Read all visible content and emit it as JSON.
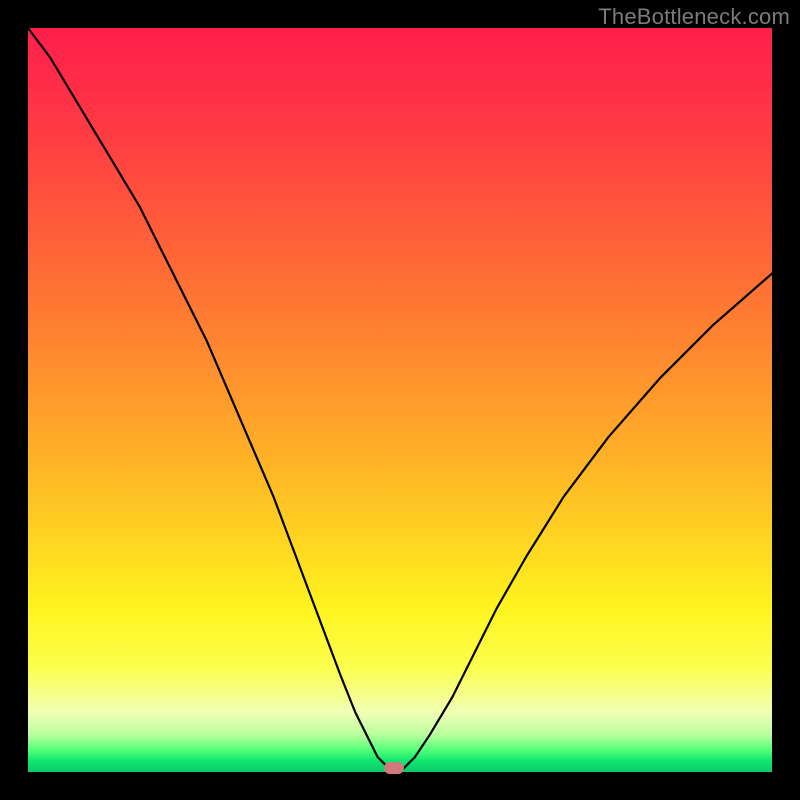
{
  "watermark": "TheBottleneck.com",
  "chart_data": {
    "type": "line",
    "title": "",
    "xlabel": "",
    "ylabel": "",
    "xlim": [
      0,
      100
    ],
    "ylim": [
      0,
      100
    ],
    "notes": "Y-axis encoded by color gradient: red≈100 (top) → green≈0 (bottom). Curve is a V-shaped mismatch/bottleneck curve with minimum ≈0 near x≈49.",
    "series": [
      {
        "name": "bottleneck-curve",
        "x": [
          0,
          3,
          6,
          9,
          12,
          15,
          18,
          21,
          24,
          27,
          30,
          33,
          36,
          39,
          42,
          44,
          46,
          47,
          48,
          49,
          50,
          51,
          52,
          54,
          57,
          60,
          63,
          67,
          72,
          78,
          85,
          92,
          100
        ],
        "values": [
          100,
          96,
          91,
          86,
          81,
          76,
          70,
          64,
          58,
          51,
          44,
          37,
          29,
          21,
          13,
          8,
          4,
          2,
          1,
          0,
          0,
          1,
          2,
          5,
          10,
          16,
          22,
          29,
          37,
          45,
          53,
          60,
          67
        ]
      }
    ],
    "marker": {
      "x": 49.2,
      "y": 0.5,
      "color": "#cf7a7d"
    },
    "gradient_stops": [
      {
        "pos": 0,
        "color": "#ff1f4a"
      },
      {
        "pos": 0.5,
        "color": "#ffac28"
      },
      {
        "pos": 0.82,
        "color": "#fff41e"
      },
      {
        "pos": 0.97,
        "color": "#55ff78"
      },
      {
        "pos": 1.0,
        "color": "#0cc86a"
      }
    ]
  }
}
